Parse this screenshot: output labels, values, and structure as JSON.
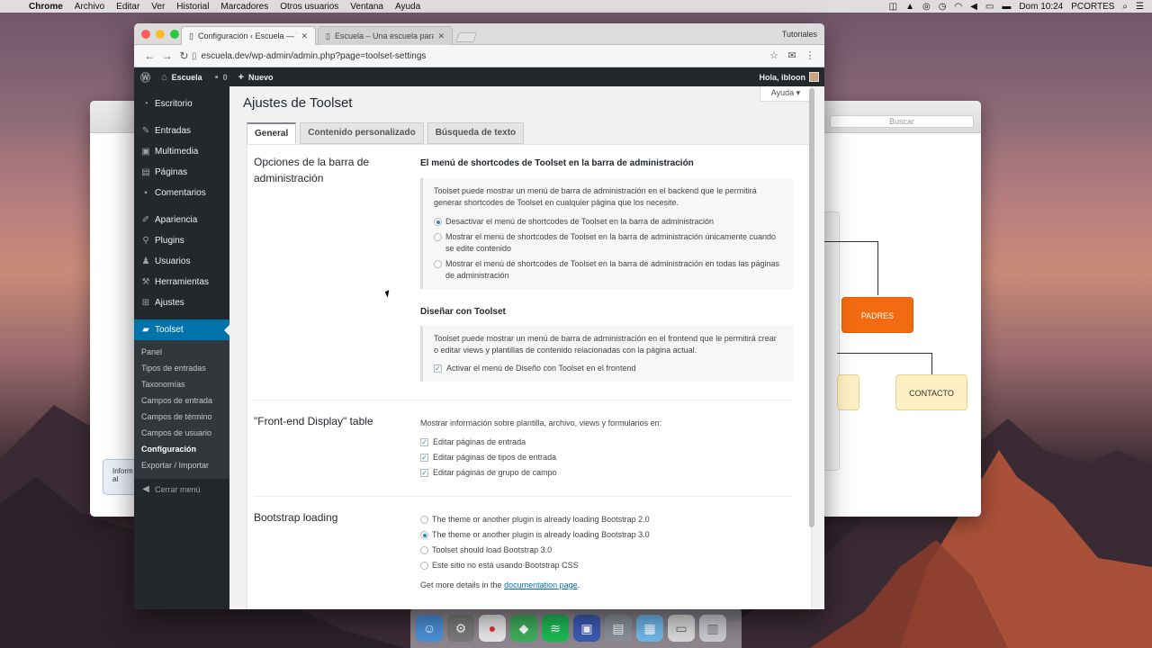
{
  "menubar": {
    "app": "Chrome",
    "items": [
      "Archivo",
      "Editar",
      "Ver",
      "Historial",
      "Marcadores",
      "Otros usuarios",
      "Ventana",
      "Ayuda"
    ],
    "clock": "Dom 10:24",
    "user": "PCORTES"
  },
  "bg_app": {
    "search_placeholder": "Buscar",
    "node_padres": "PADRES",
    "node_contacto": "CONTACTO",
    "info_snippet": "Inform al"
  },
  "browser": {
    "tabs": [
      {
        "title": "Configuración ‹ Escuela — Wo",
        "active": true
      },
      {
        "title": "Escuela – Una escuela para ap",
        "active": false
      }
    ],
    "profile": "Tutoriales",
    "url": "escuela.dev/wp-admin/admin.php?page=toolset-settings"
  },
  "wpbar": {
    "site": "Escuela",
    "comments": "0",
    "new": "Nuevo",
    "greeting": "Hola, ibloon"
  },
  "sidebar": {
    "items": [
      {
        "label": "Escritorio",
        "icon": "dashboard-icon"
      },
      {
        "label": "Entradas",
        "icon": "pin-icon"
      },
      {
        "label": "Multimedia",
        "icon": "media-icon"
      },
      {
        "label": "Páginas",
        "icon": "page-icon"
      },
      {
        "label": "Comentarios",
        "icon": "comment-icon"
      },
      {
        "label": "Apariencia",
        "icon": "brush-icon"
      },
      {
        "label": "Plugins",
        "icon": "plugin-icon"
      },
      {
        "label": "Usuarios",
        "icon": "user-icon"
      },
      {
        "label": "Herramientas",
        "icon": "wrench-icon"
      },
      {
        "label": "Ajustes",
        "icon": "settings-icon"
      },
      {
        "label": "Toolset",
        "icon": "toolset-icon"
      }
    ],
    "submenu": [
      "Panel",
      "Tipos de entradas",
      "Taxonomías",
      "Campos de entrada",
      "Campos de término",
      "Campos de usuario",
      "Configuración",
      "Exportar / Importar"
    ],
    "collapse": "Cerrar menú"
  },
  "page": {
    "help": "Ayuda",
    "title": "Ajustes de Toolset",
    "tabs": [
      "General",
      "Contenido personalizado",
      "Búsqueda de texto"
    ],
    "admin_bar_section": {
      "title": "Opciones de la barra de administración",
      "heading": "El menú de shortcodes de Toolset en la barra de administración",
      "description": "Toolset puede mostrar un menú de barra de administración en el backend que le permitirá generar shortcodes de Toolset en cualquier página que los necesite.",
      "options": [
        "Desactivar el menú de shortcodes de Toolset en la barra de administración",
        "Mostrar el menú de shortcodes de Toolset en la barra de administración únicamente cuando se edite contenido",
        "Mostrar el menú de shortcodes de Toolset en la barra de administración en todas las páginas de administración"
      ],
      "design_heading": "Diseñar con Toolset",
      "design_description": "Toolset puede mostrar un menú de barra de administración en el frontend que le permitirá crear o editar views y plantillas de contenido relacionadas con la página actual.",
      "design_checkbox": "Activar el menú de Diseño con Toolset en el frontend"
    },
    "frontend_section": {
      "title": "\"Front-end Display\" table",
      "intro": "Mostrar información sobre plantilla, archivo, views y formularios en:",
      "checkboxes": [
        "Editar páginas de entrada",
        "Editar páginas de tipos de entrada",
        "Editar páginas de grupo de campo"
      ]
    },
    "bootstrap_section": {
      "title": "Bootstrap loading",
      "options": [
        "The theme or another plugin is already loading Bootstrap 2.0",
        "The theme or another plugin is already loading Bootstrap 3.0",
        "Toolset should load Bootstrap 3.0",
        "Este sitio no está usando Bootstrap CSS"
      ],
      "details_prefix": "Get more details in the",
      "details_link": "documentation page",
      "details_suffix": "."
    }
  },
  "colors": {
    "wp_dark": "#23282d",
    "wp_blue": "#0073aa",
    "flow_orange": "#f26b10",
    "flow_yellow": "#fcf0c4"
  }
}
